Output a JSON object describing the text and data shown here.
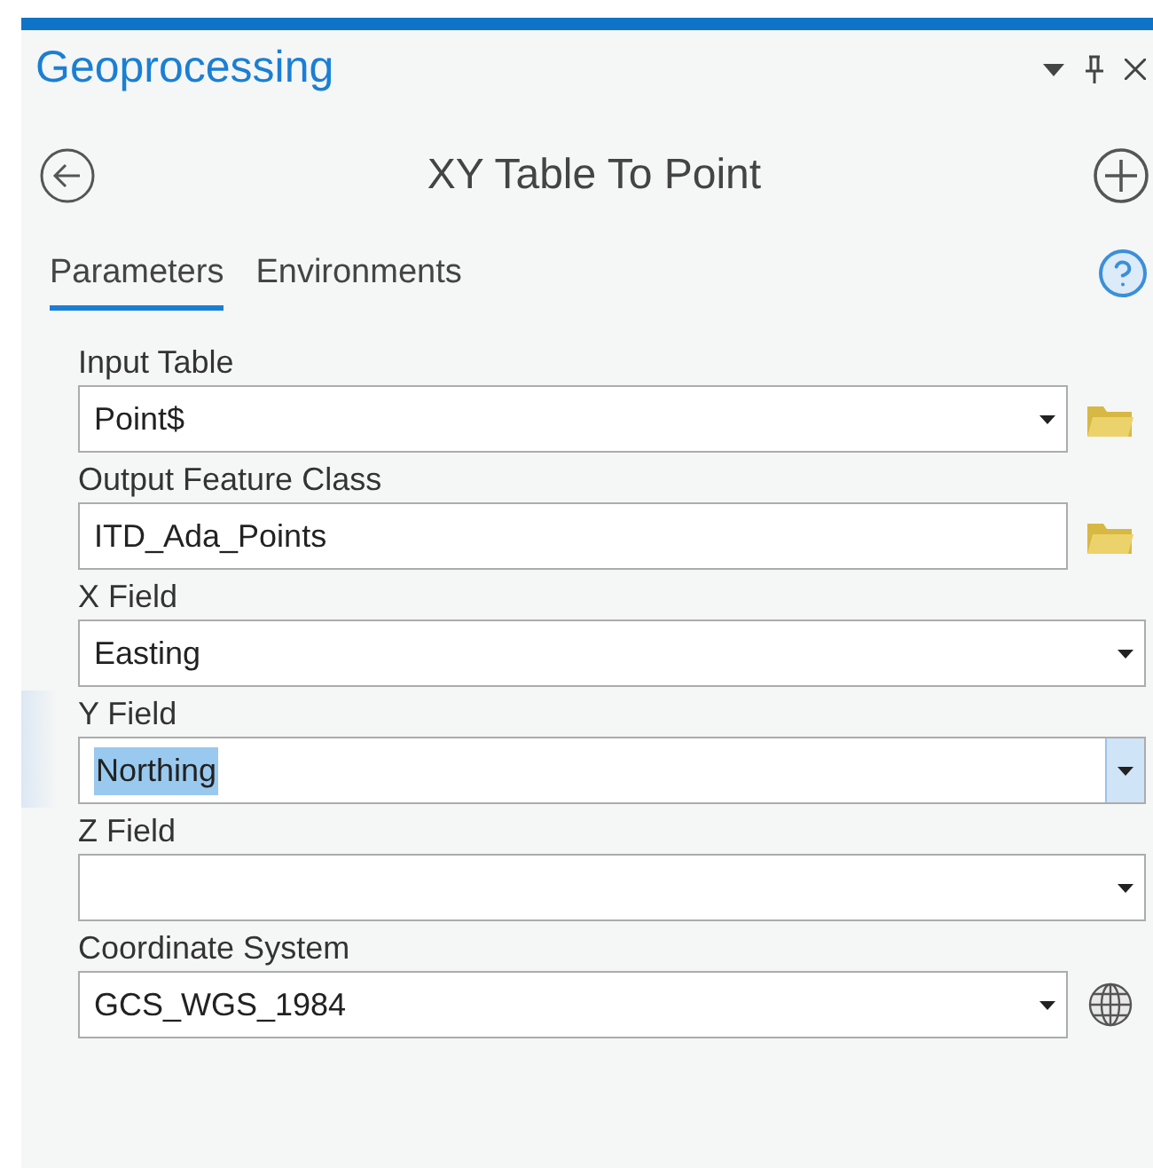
{
  "pane": {
    "title": "Geoprocessing"
  },
  "tool": {
    "title": "XY Table To Point"
  },
  "tabs": [
    {
      "label": "Parameters",
      "selected": true
    },
    {
      "label": "Environments",
      "selected": false
    }
  ],
  "parameters": [
    {
      "label": "Input Table",
      "value": "Point$",
      "kind": "dropdown",
      "button": {
        "kind": "folder"
      },
      "focused": false
    },
    {
      "label": "Output Feature Class",
      "value": "ITD_Ada_Points",
      "kind": "text",
      "button": {
        "kind": "folder"
      },
      "focused": false
    },
    {
      "label": "X Field",
      "value": "Easting",
      "kind": "dropdown",
      "focused": false
    },
    {
      "label": "Y Field",
      "value": "Northing",
      "kind": "dropdown",
      "focused": true
    },
    {
      "label": "Z Field",
      "kind": "dropdown",
      "focused": false
    },
    {
      "label": "Coordinate System",
      "value": "GCS_WGS_1984",
      "kind": "dropdown",
      "button": {
        "kind": "globe"
      },
      "focused": false
    }
  ]
}
